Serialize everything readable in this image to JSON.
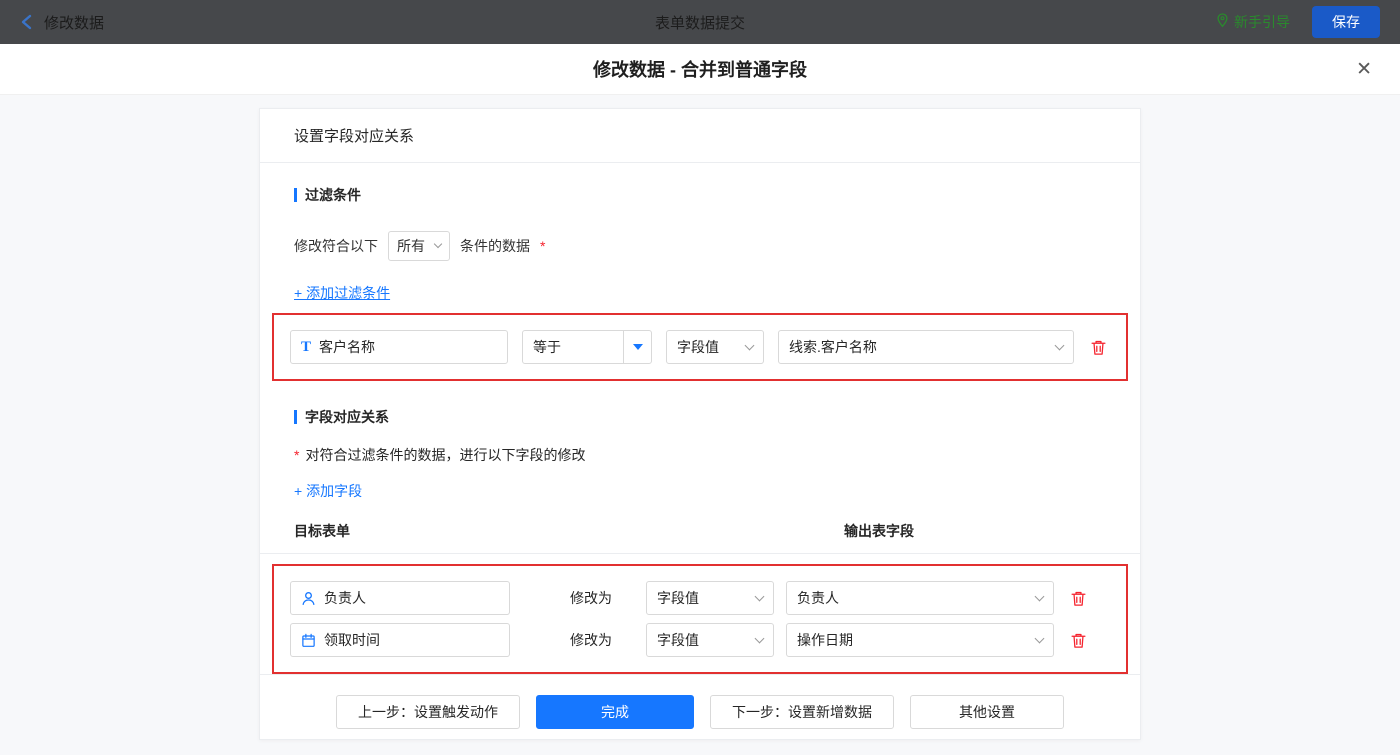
{
  "colors": {
    "accent": "#1677ff",
    "danger": "#f5222d",
    "highlight_border": "#e23030",
    "guide_green": "#2a8a2d",
    "save_blue": "#1a5ac8"
  },
  "topbar": {
    "back_label": "修改数据",
    "title": "表单数据提交",
    "guide_label": "新手引导",
    "save_label": "保存"
  },
  "modal": {
    "title": "修改数据 - 合并到普通字段",
    "close_glyph": "✕"
  },
  "card": {
    "header": "设置字段对应关系",
    "filter": {
      "title": "过滤条件",
      "prefix": "修改符合以下",
      "scope_value": "所有",
      "suffix": "条件的数据",
      "required_mark": "*",
      "add_link": "+ 添加过滤条件",
      "row": {
        "field": "客户名称",
        "operator": "等于",
        "value_type": "字段值",
        "value": "线索.客户名称"
      }
    },
    "mapping": {
      "title": "字段对应关系",
      "required_mark": "*",
      "description": "对符合过滤条件的数据，进行以下字段的修改",
      "add_link": "+ 添加字段",
      "col_target": "目标表单",
      "col_output": "输出表字段",
      "modify_label": "修改为",
      "rows": [
        {
          "field": "负责人",
          "value_type": "字段值",
          "value": "负责人"
        },
        {
          "field": "领取时间",
          "value_type": "字段值",
          "value": "操作日期"
        }
      ]
    },
    "footer": {
      "prev": "上一步：设置触发动作",
      "done": "完成",
      "next": "下一步：设置新增数据",
      "other": "其他设置"
    }
  }
}
